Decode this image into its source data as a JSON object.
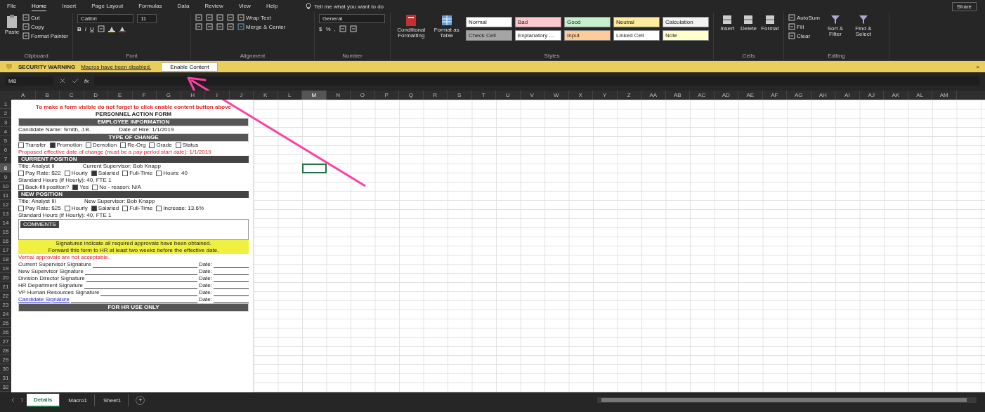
{
  "menu_tabs": [
    {
      "label": "File",
      "selected": false
    },
    {
      "label": "Home",
      "selected": true
    },
    {
      "label": "Insert",
      "selected": false
    },
    {
      "label": "Page Layout",
      "selected": false
    },
    {
      "label": "Formulas",
      "selected": false
    },
    {
      "label": "Data",
      "selected": false
    },
    {
      "label": "Review",
      "selected": false
    },
    {
      "label": "View",
      "selected": false
    },
    {
      "label": "Help",
      "selected": false
    }
  ],
  "tell_me": "Tell me what you want to do",
  "share": "Share",
  "ribbon": {
    "clipboard": {
      "paste": "Paste",
      "items": [
        "Cut",
        "Copy",
        "Format Painter"
      ],
      "label": "Clipboard"
    },
    "font": {
      "name": "Calibri",
      "size": "11",
      "styles": [
        "B",
        "I",
        "U"
      ],
      "label": "Font"
    },
    "alignment": {
      "wrap": "Wrap Text",
      "merge": "Merge & Center",
      "label": "Alignment"
    },
    "number": {
      "format": "General",
      "symbols": [
        "$",
        "%",
        ","
      ],
      "label": "Number"
    },
    "styles": {
      "conditional": "Conditional Formatting",
      "table": "Format as Table",
      "label": "Styles",
      "cells": [
        {
          "label": "Normal",
          "color": "#ffffff"
        },
        {
          "label": "Bad",
          "color": "#ffc7ce"
        },
        {
          "label": "Good",
          "color": "#c6efce"
        },
        {
          "label": "Neutral",
          "color": "#ffeb9c"
        },
        {
          "label": "Calculation",
          "color": "#f2f2f2"
        },
        {
          "label": "Check Cell",
          "color": "#a5a5a5"
        },
        {
          "label": "Explanatory ...",
          "color": "#ffffff"
        },
        {
          "label": "Input",
          "color": "#ffcc99"
        },
        {
          "label": "Linked Cell",
          "color": "#ffffff"
        },
        {
          "label": "Note",
          "color": "#ffffcc"
        }
      ]
    },
    "cells": {
      "buttons": [
        "Insert",
        "Delete",
        "Format"
      ],
      "label": "Cells"
    },
    "editing": {
      "items": [
        "AutoSum",
        "Fill",
        "Clear"
      ],
      "sort": "Sort & Filter",
      "find": "Find & Select",
      "label": "Editing"
    }
  },
  "security": {
    "title": "SECURITY WARNING",
    "message": "Macros have been disabled.",
    "button": "Enable Content",
    "close": "×"
  },
  "formula_bar": {
    "name_box": "M8",
    "fx": "fx"
  },
  "columns": [
    {
      "label": "A",
      "selected": false
    },
    {
      "label": "B",
      "selected": false
    },
    {
      "label": "C",
      "selected": false
    },
    {
      "label": "D",
      "selected": false
    },
    {
      "label": "E",
      "selected": false
    },
    {
      "label": "F",
      "selected": false
    },
    {
      "label": "G",
      "selected": false
    },
    {
      "label": "H",
      "selected": false
    },
    {
      "label": "I",
      "selected": false
    },
    {
      "label": "J",
      "selected": false
    },
    {
      "label": "K",
      "selected": false
    },
    {
      "label": "L",
      "selected": false
    },
    {
      "label": "M",
      "selected": true
    },
    {
      "label": "N",
      "selected": false
    },
    {
      "label": "O",
      "selected": false
    },
    {
      "label": "P",
      "selected": false
    },
    {
      "label": "Q",
      "selected": false
    },
    {
      "label": "R",
      "selected": false
    },
    {
      "label": "S",
      "selected": false
    },
    {
      "label": "T",
      "selected": false
    },
    {
      "label": "U",
      "selected": false
    },
    {
      "label": "V",
      "selected": false
    },
    {
      "label": "W",
      "selected": false
    },
    {
      "label": "X",
      "selected": false
    },
    {
      "label": "Y",
      "selected": false
    },
    {
      "label": "Z",
      "selected": false
    },
    {
      "label": "AA",
      "selected": false
    },
    {
      "label": "AB",
      "selected": false
    },
    {
      "label": "AC",
      "selected": false
    },
    {
      "label": "AD",
      "selected": false
    },
    {
      "label": "AE",
      "selected": false
    },
    {
      "label": "AF",
      "selected": false
    },
    {
      "label": "AG",
      "selected": false
    },
    {
      "label": "AH",
      "selected": false
    },
    {
      "label": "AI",
      "selected": false
    },
    {
      "label": "AJ",
      "selected": false
    },
    {
      "label": "AK",
      "selected": false
    },
    {
      "label": "AL",
      "selected": false
    },
    {
      "label": "AM",
      "selected": false
    }
  ],
  "rows": [
    {
      "label": "1",
      "selected": false
    },
    {
      "label": "2",
      "selected": false
    },
    {
      "label": "3",
      "selected": false
    },
    {
      "label": "4",
      "selected": false
    },
    {
      "label": "5",
      "selected": false
    },
    {
      "label": "6",
      "selected": false
    },
    {
      "label": "7",
      "selected": false
    },
    {
      "label": "8",
      "selected": true
    },
    {
      "label": "9",
      "selected": false
    },
    {
      "label": "10",
      "selected": false
    },
    {
      "label": "11",
      "selected": false
    },
    {
      "label": "12",
      "selected": false
    },
    {
      "label": "13",
      "selected": false
    },
    {
      "label": "14",
      "selected": false
    },
    {
      "label": "15",
      "selected": false
    },
    {
      "label": "16",
      "selected": false
    },
    {
      "label": "17",
      "selected": false
    },
    {
      "label": "18",
      "selected": false
    },
    {
      "label": "19",
      "selected": false
    },
    {
      "label": "20",
      "selected": false
    },
    {
      "label": "21",
      "selected": false
    },
    {
      "label": "22",
      "selected": false
    },
    {
      "label": "23",
      "selected": false
    },
    {
      "label": "24",
      "selected": false
    },
    {
      "label": "25",
      "selected": false
    },
    {
      "label": "26",
      "selected": false
    },
    {
      "label": "27",
      "selected": false
    },
    {
      "label": "28",
      "selected": false
    },
    {
      "label": "29",
      "selected": false
    },
    {
      "label": "30",
      "selected": false
    },
    {
      "label": "31",
      "selected": false
    },
    {
      "label": "32",
      "selected": false
    }
  ],
  "form": [
    {
      "kind": "notice",
      "text": "To make a form visible do not forget to click enable content button above"
    },
    {
      "kind": "title",
      "text": "PERSONNEL ACTION FORM"
    },
    {
      "kind": "bar",
      "text": "EMPLOYEE INFORMATION"
    },
    {
      "kind": "fields",
      "items": [
        "Candidate Name:  Smith, J.B.",
        "Date of Hire:  1/1/2019"
      ]
    },
    {
      "kind": "bar",
      "text": "TYPE OF CHANGE"
    },
    {
      "kind": "checks",
      "items": [
        {
          "label": "Transfer",
          "checked": false
        },
        {
          "label": "Promotion",
          "checked": true
        },
        {
          "label": "Demotion",
          "checked": false
        },
        {
          "label": "Re-Org",
          "checked": false
        },
        {
          "label": "Grade",
          "checked": false
        },
        {
          "label": "Status",
          "checked": false
        }
      ]
    },
    {
      "kind": "note",
      "text": "Proposed effective date of change (must be a pay period start date):  1/1/2019"
    },
    {
      "kind": "label",
      "text": "CURRENT POSITION"
    },
    {
      "kind": "fields",
      "items": [
        "Title:  Analyst II",
        "Current Supervisor:  Bob Knapp"
      ]
    },
    {
      "kind": "checks",
      "items": [
        {
          "label": "Pay Rate:  $22",
          "checked": false
        },
        {
          "label": "Hourly",
          "checked": false
        },
        {
          "label": "Salaried",
          "checked": true
        },
        {
          "label": "Full-Time",
          "checked": false
        },
        {
          "label": "Hours:  40",
          "checked": false
        }
      ]
    },
    {
      "kind": "fields",
      "items": [
        "Standard Hours (if Hourly): 40, FTE 1"
      ]
    },
    {
      "kind": "checks",
      "items": [
        {
          "label": "Back-fill position?",
          "checked": false
        },
        {
          "label": "Yes",
          "checked": true
        },
        {
          "label": "No - reason:  N/A",
          "checked": false
        }
      ]
    },
    {
      "kind": "label",
      "text": "NEW POSITION"
    },
    {
      "kind": "fields",
      "items": [
        "Title:  Analyst III",
        "New Supervisor:  Bob Knapp"
      ]
    },
    {
      "kind": "checks",
      "items": [
        {
          "label": "Pay Rate:  $25",
          "checked": false
        },
        {
          "label": "Hourly",
          "checked": false
        },
        {
          "label": "Salaried",
          "checked": true
        },
        {
          "label": "Full-Time",
          "checked": false
        },
        {
          "label": "Increase:  13.6%",
          "checked": false
        }
      ]
    },
    {
      "kind": "fields",
      "items": [
        "Standard Hours (if Hourly): 40, FTE 1"
      ]
    },
    {
      "kind": "comments",
      "text": "COMMENTS"
    },
    {
      "kind": "highlight",
      "text": "Signatures indicate all required approvals have been obtained."
    },
    {
      "kind": "highlight",
      "text": "Forward this form to HR at least two weeks before the effective date."
    },
    {
      "kind": "note",
      "text": "Verbal approvals are not acceptable."
    },
    {
      "kind": "signature",
      "label": "Current Supervisor Signature",
      "date": "Date:"
    },
    {
      "kind": "signature",
      "label": "New Supervisor Signature",
      "date": "Date:"
    },
    {
      "kind": "signature",
      "label": "Division Director Signature",
      "date": "Date:"
    },
    {
      "kind": "signature",
      "label": "HR Department Signature",
      "date": "Date:"
    },
    {
      "kind": "signature",
      "label": "VP Human Resources Signature",
      "date": "Date:"
    },
    {
      "kind": "link-signature",
      "label": "Candidate Signature",
      "date": "Date:"
    },
    {
      "kind": "bar",
      "text": "FOR HR USE ONLY"
    }
  ],
  "sheet_tabs": [
    {
      "label": "Details",
      "selected": true
    },
    {
      "label": "Macro1",
      "selected": false
    },
    {
      "label": "Sheet1",
      "selected": false
    }
  ],
  "add_sheet": "+"
}
